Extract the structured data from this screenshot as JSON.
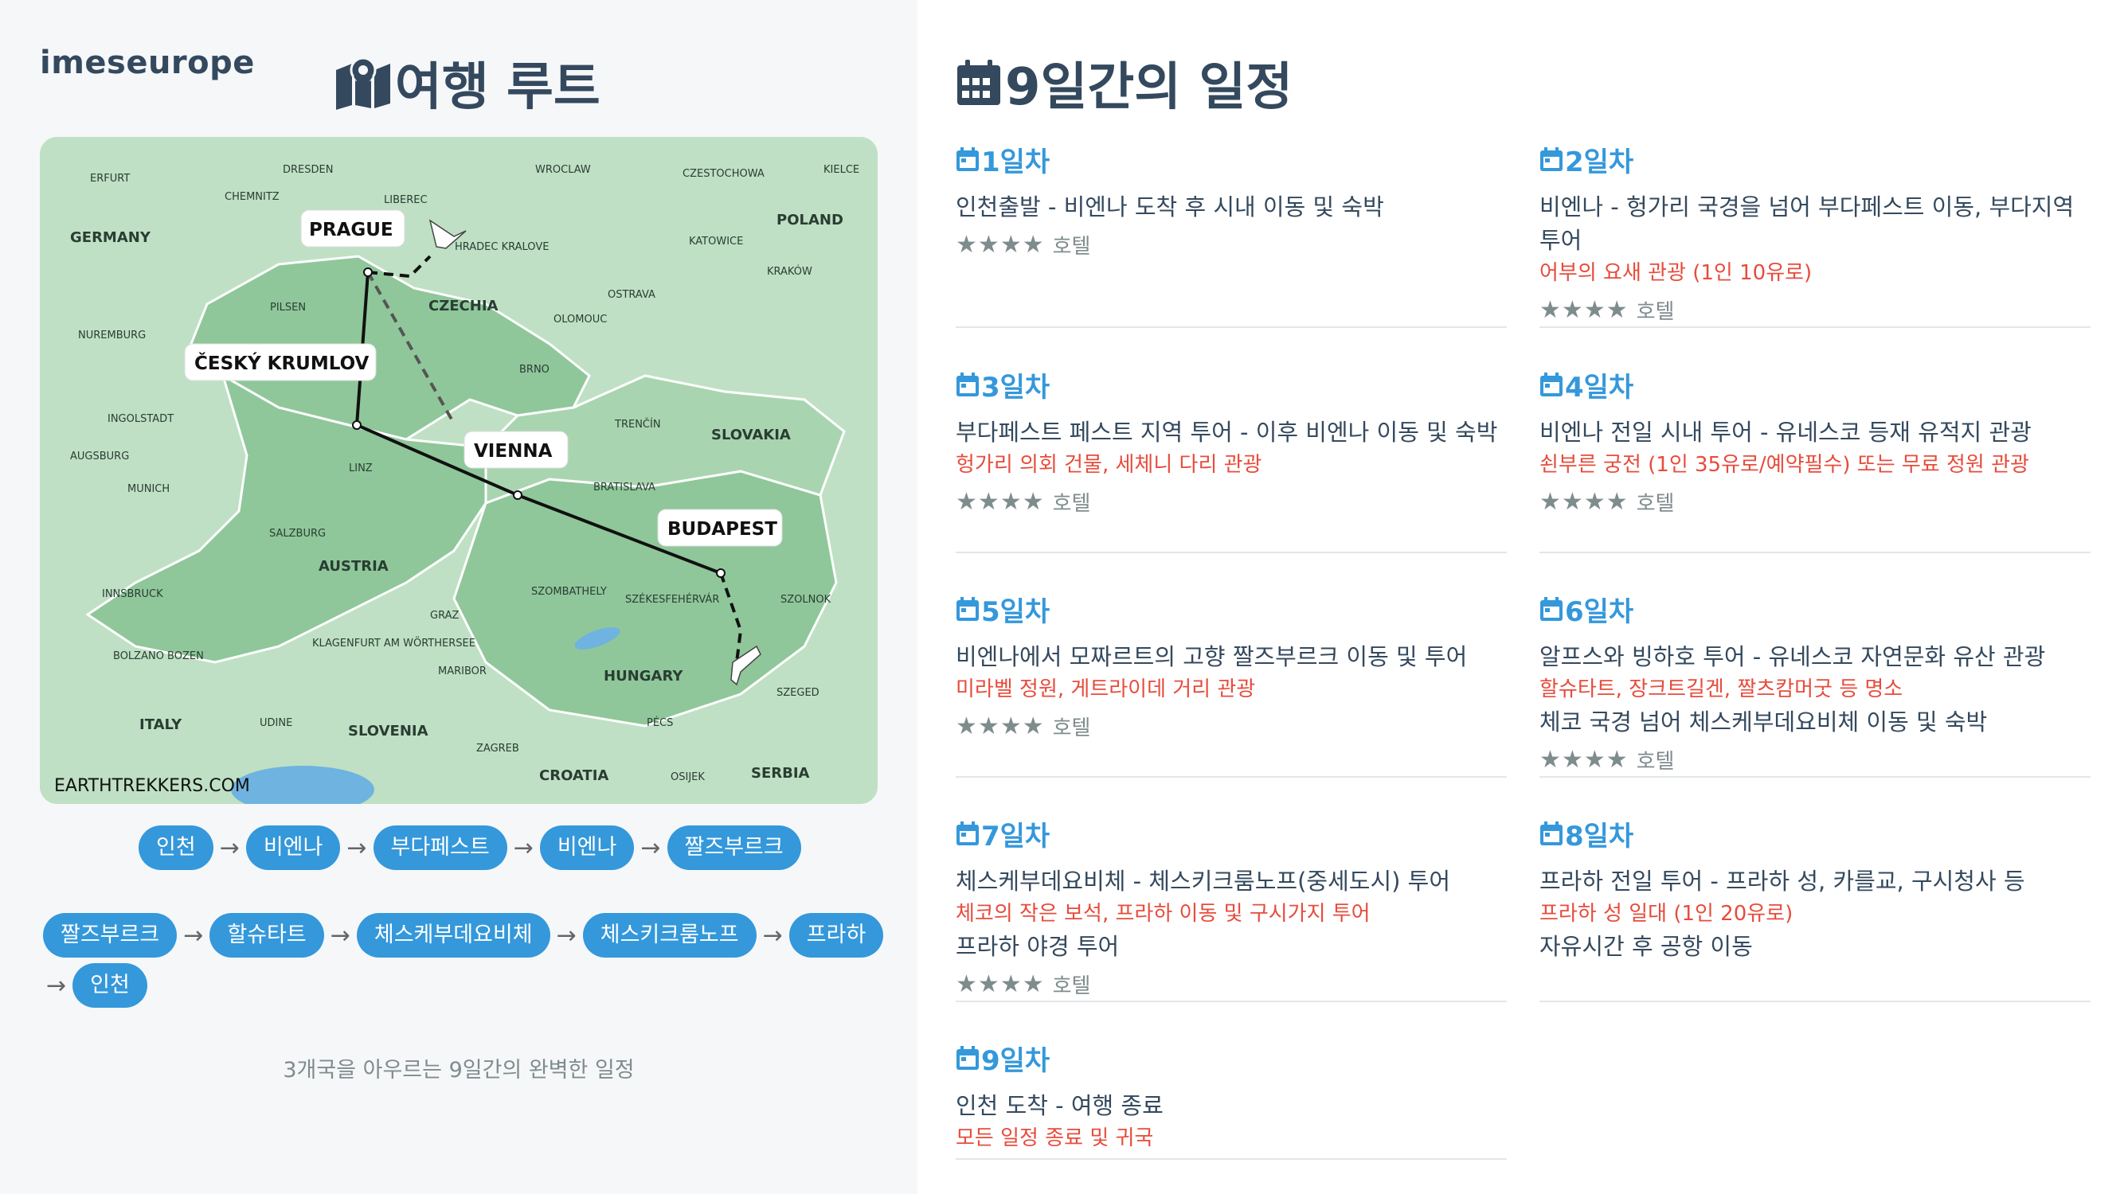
{
  "brand": "imeseurope",
  "route_title": "여행 루트",
  "map": {
    "credit": "EARTHTREKKERS.COM",
    "countries": [
      "GERMANY",
      "POLAND",
      "CZECHIA",
      "SLOVAKIA",
      "AUSTRIA",
      "HUNGARY",
      "ITALY",
      "SLOVENIA",
      "CROATIA",
      "SERBIA"
    ],
    "cities": [
      "ERFURT",
      "DRESDEN",
      "CHEMNITZ",
      "LIBEREC",
      "WROCLAW",
      "CZESTOCHOWA",
      "KIELCE",
      "HRADEC KRALOVE",
      "KATOWICE",
      "KRAKÓW",
      "OSTRAVA",
      "PILSEN",
      "OLOMOUC",
      "NUREMBURG",
      "BRNO",
      "INGOLSTADT",
      "TRENČÍN",
      "AUGSBURG",
      "LINZ",
      "MUNICH",
      "BRATISLAVA",
      "SALZBURG",
      "INNSBRUCK",
      "SZOMBATHELY",
      "SZÉKESFEHÉRVÁR",
      "SZOLNOK",
      "GRAZ",
      "BOLZANO BOZEN",
      "KLAGENFURT AM WÖRTHERSEE",
      "MARIBOR",
      "SZEGED",
      "UDINE",
      "PÉCS",
      "ZAGREB",
      "OSIJEK"
    ],
    "stops": [
      "PRAGUE",
      "ČESKÝ KRUMLOV",
      "VIENNA",
      "BUDAPEST"
    ]
  },
  "route_row1": [
    "인천",
    "비엔나",
    "부다페스트",
    "비엔나",
    "짤즈부르크"
  ],
  "route_row2": [
    "짤즈부르크",
    "할슈타트",
    "체스케부데요비체",
    "체스키크룸노프",
    "프라하"
  ],
  "route_row3": [
    "인천"
  ],
  "summary": "3개국을 아우르는 9일간의 완벽한 일정",
  "schedule_title": "9일간의 일정",
  "days": [
    {
      "label": "1일차",
      "lines": [
        "인천출발 - 비엔나 도착 후 시내 이동 및 숙박"
      ],
      "notes": [],
      "hotel": "호텔"
    },
    {
      "label": "2일차",
      "lines": [
        "비엔나 - 헝가리 국경을 넘어 부다페스트 이동, 부다지역 투어"
      ],
      "notes": [
        "어부의 요새 관광 (1인 10유로)"
      ],
      "hotel": "호텔"
    },
    {
      "label": "3일차",
      "lines": [
        "부다페스트 페스트 지역 투어 - 이후 비엔나 이동 및 숙박"
      ],
      "notes": [
        "헝가리 의회 건물, 세체니 다리 관광"
      ],
      "hotel": "호텔"
    },
    {
      "label": "4일차",
      "lines": [
        "비엔나 전일 시내 투어 - 유네스코 등재 유적지 관광"
      ],
      "notes": [
        "쇤부른 궁전 (1인 35유로/예약필수) 또는 무료 정원 관광"
      ],
      "hotel": "호텔"
    },
    {
      "label": "5일차",
      "lines": [
        "비엔나에서 모짜르트의 고향 짤즈부르크 이동 및 투어"
      ],
      "notes": [
        "미라벨 정원, 게트라이데 거리 관광"
      ],
      "hotel": "호텔"
    },
    {
      "label": "6일차",
      "lines": [
        "알프스와 빙하호 투어 - 유네스코 자연문화 유산 관광"
      ],
      "notes": [
        "할슈타트, 장크트길겐, 짤츠캄머굿 등 명소"
      ],
      "extra": "체코 국경 넘어 체스케부데요비체 이동 및 숙박",
      "hotel": "호텔"
    },
    {
      "label": "7일차",
      "lines": [
        "체스케부데요비체 - 체스키크룸노프(중세도시) 투어"
      ],
      "notes": [
        "체코의 작은 보석, 프라하 이동 및 구시가지 투어"
      ],
      "extra": "프라하 야경 투어",
      "hotel": "호텔"
    },
    {
      "label": "8일차",
      "lines": [
        "프라하 전일 투어 - 프라하 성, 카를교, 구시청사 등"
      ],
      "notes": [
        "프라하 성 일대 (1인 20유로)"
      ],
      "extra": "자유시간 후 공항 이동",
      "hotel": null
    },
    {
      "label": "9일차",
      "lines": [
        "인천 도착 - 여행 종료"
      ],
      "notes": [
        "모든 일정 종료 및 귀국"
      ],
      "hotel": null
    }
  ],
  "colors": {
    "accent": "#3498db",
    "note": "#e74c3c",
    "title": "#34495e",
    "muted": "#7f8c8d"
  }
}
